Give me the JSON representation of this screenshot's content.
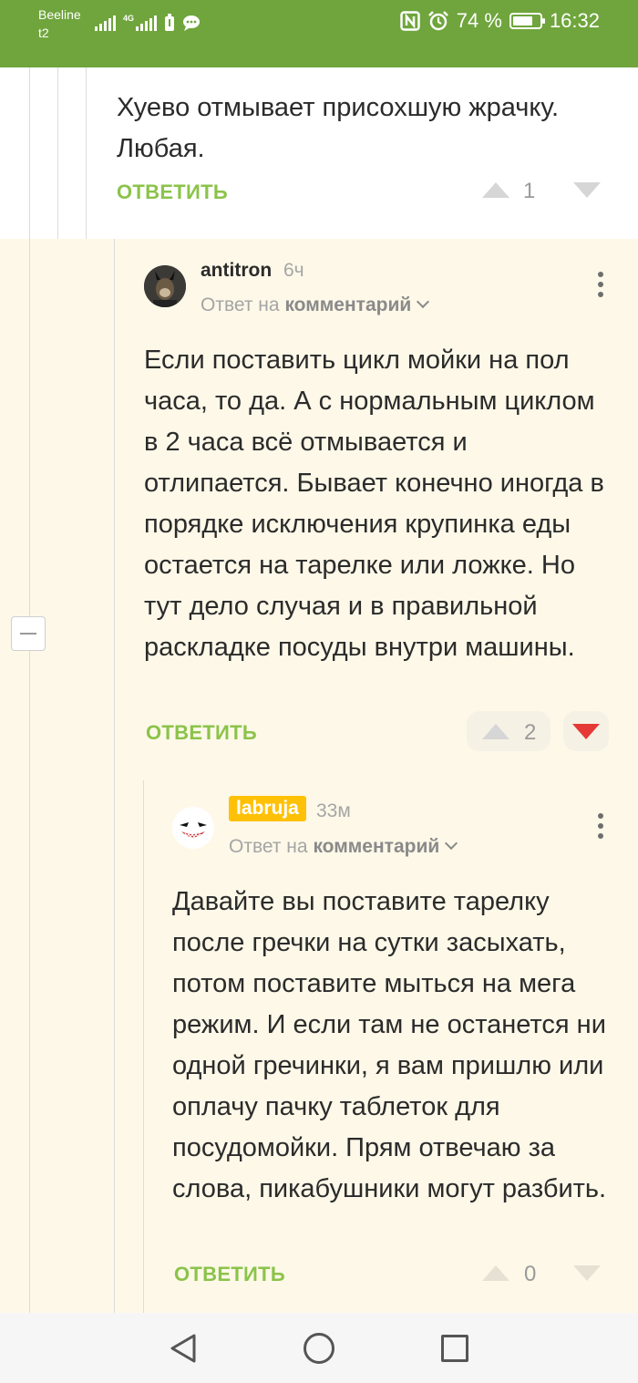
{
  "status_bar": {
    "carrier_line1": "Beeline",
    "carrier_line2": "t2",
    "network_type": "4G",
    "battery_percent": "74 %",
    "battery_level": 0.74,
    "time": "16:32",
    "icons": [
      "signal-icon",
      "signal-4g-icon",
      "battery-saver-icon",
      "chat-bubble-icon",
      "nfc-icon",
      "alarm-icon",
      "battery-icon"
    ]
  },
  "comments": [
    {
      "text": "Хуево отмывает присохшую жрачку. Любая.",
      "reply_label": "ОТВЕТИТЬ",
      "rating": "1"
    },
    {
      "username": "antitron",
      "time": "6ч",
      "reply_to_prefix": "Ответ на",
      "reply_to_target": "комментарий",
      "text": "Если поставить цикл мойки на пол часа, то да. А с нормальным циклом в 2 часа всё отмывается и отлипается. Бывает конечно иногда в порядке исключения крупинка еды остается на тарелке или ложке. Но тут дело случая и в правильной раскладке посуды внутри машины.",
      "reply_label": "ОТВЕТИТЬ",
      "rating": "2",
      "downvoted": true
    },
    {
      "username": "labruja",
      "time": "33м",
      "reply_to_prefix": "Ответ на",
      "reply_to_target": "комментарий",
      "text": "Давайте вы поставите тарелку после гречки на сутки засыхать, потом поставите мыться на мега режим. И если там не останется ни одной гречинки, я вам пришлю или оплачу пачку таблеток для посудомойки. Прям отвечаю за слова, пикабушники могут разбить.",
      "reply_label": "ОТВЕТИТЬ",
      "rating": "0"
    }
  ],
  "colors": {
    "status_bar": "#6fa53c",
    "accent_green": "#8bc34a",
    "nested_background": "#fdf8e8",
    "downvote_active": "#e53935",
    "user_badge": "#ffc107"
  }
}
